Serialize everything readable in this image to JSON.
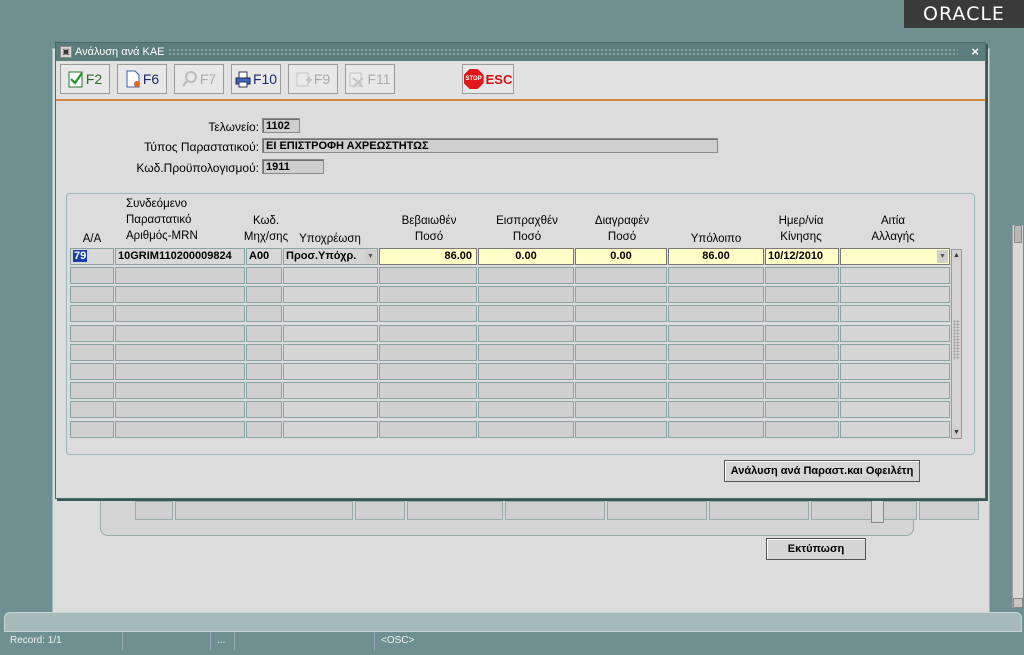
{
  "brand": {
    "logo_text": "ORACLE"
  },
  "window": {
    "title": "Ανάλυση ανά ΚΑΕ",
    "close_glyph": "×"
  },
  "toolbar": {
    "buttons": [
      {
        "key": "F2",
        "icon": "save-check-icon",
        "enabled": true
      },
      {
        "key": "F6",
        "icon": "new-document-icon",
        "enabled": true
      },
      {
        "key": "F7",
        "icon": "search-magnifier-icon",
        "enabled": false
      },
      {
        "key": "F10",
        "icon": "printer-icon",
        "enabled": true
      },
      {
        "key": "F9",
        "icon": "add-record-icon",
        "enabled": false
      },
      {
        "key": "F11",
        "icon": "delete-record-icon",
        "enabled": false
      }
    ],
    "stop": {
      "icon_text": "STOP",
      "label": "ESC"
    }
  },
  "form": {
    "customs_label": "Τελωνείο:",
    "customs_value": "1102",
    "doc_type_label": "Τύπος Παραστατικού:",
    "doc_type_value": "ΕΙ ΕΠΙΣΤΡΟΦΗ ΑΧΡΕΩΣΤΗΤΩΣ",
    "budget_label": "Κωδ.Προϋπολογισμού:",
    "budget_value": "1911"
  },
  "grid": {
    "headers": {
      "aa": "Α/Α",
      "mrn": [
        "Συνδεόμενο",
        "Παραστατικό",
        "Αριθμός-MRN"
      ],
      "mech": [
        "Κωδ.",
        "Μηχ/σης"
      ],
      "obligation": "Υποχρέωση",
      "certified": [
        "Βεβαιωθέν",
        "Ποσό"
      ],
      "collected": [
        "Εισπραχθέν",
        "Ποσό"
      ],
      "written_off": [
        "Διαγραφέν",
        "Ποσό"
      ],
      "balance": "Υπόλοιπο",
      "date": [
        "Ημερ/νία",
        "Κίνησης"
      ],
      "reason": [
        "Αιτία",
        "Αλλαγής"
      ]
    },
    "rows": [
      {
        "aa": "79",
        "mrn": "10GRIM110200009824",
        "mech": "A00",
        "obligation": "Προσ.Υπόχρ.",
        "certified": "86.00",
        "collected": "0.00",
        "written_off": "0.00",
        "balance": "86.00",
        "date": "10/12/2010",
        "reason": ""
      }
    ],
    "empty_rows": 9
  },
  "buttons": {
    "analysis": "Ανάλυση ανά Παραστ.και Οφειλέτη",
    "print": "Εκτύπωση"
  },
  "status_bar": {
    "record": "Record: 1/1",
    "ellipsis": "...",
    "mode": "<OSC>"
  }
}
